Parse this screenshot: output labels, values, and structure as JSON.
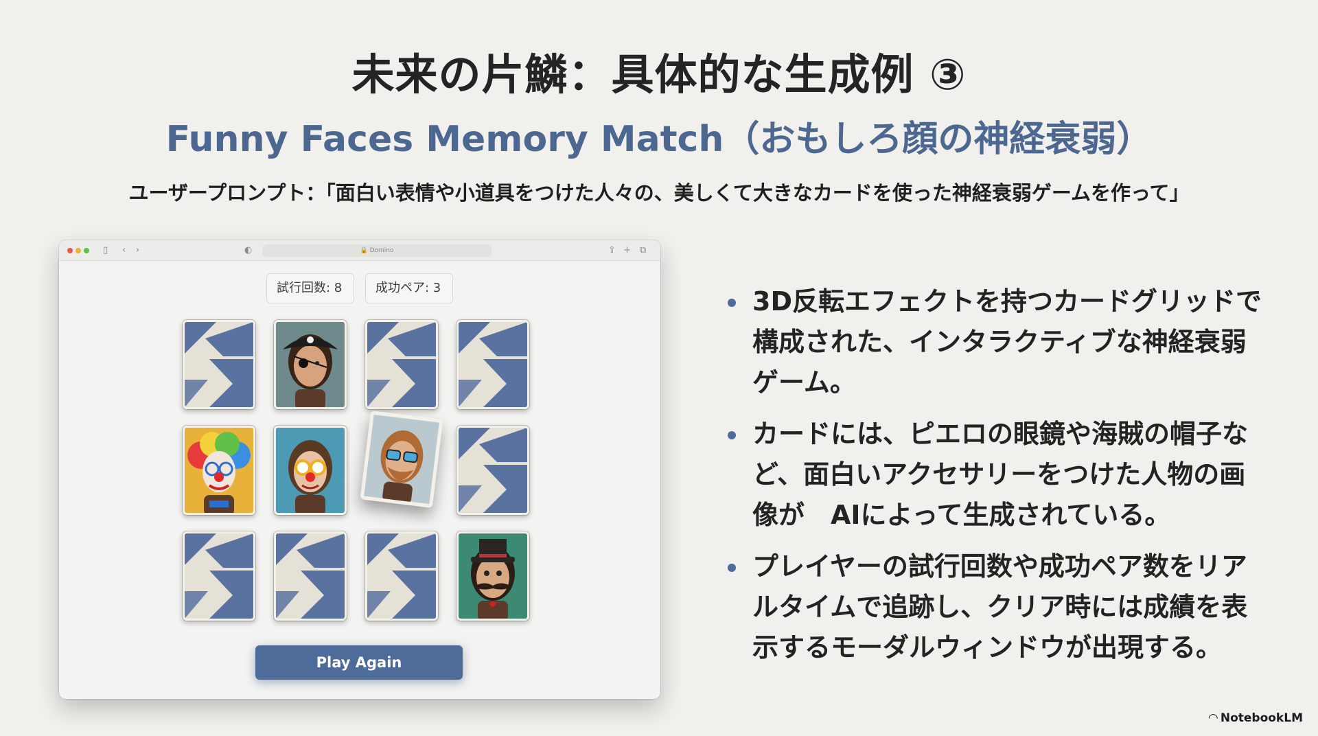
{
  "slide": {
    "title": "未来の片鱗：具体的な生成例 ③",
    "subtitle": "Funny Faces Memory Match（おもしろ顔の神経衰弱）",
    "prompt": "ユーザープロンプト：「面白い表情や小道具をつけた人々の、美しくて大きなカードを使った神経衰弱ゲームを作って」"
  },
  "browser": {
    "address": "🔒 Domino",
    "icons": [
      "sidebar-icon",
      "back-icon",
      "forward-icon",
      "shield-icon",
      "share-icon",
      "new-tab-icon",
      "tabs-icon"
    ]
  },
  "game": {
    "attempts_label": "試行回数: 8",
    "pairs_label": "成功ペア: 3",
    "play_again": "Play Again",
    "cards": [
      {
        "state": "back"
      },
      {
        "state": "face",
        "face": "pirate"
      },
      {
        "state": "back"
      },
      {
        "state": "back"
      },
      {
        "state": "face",
        "face": "clown-rainbow-wig"
      },
      {
        "state": "face",
        "face": "man-clown-glasses"
      },
      {
        "state": "face",
        "face": "bearded-man-sunglasses",
        "flipping": true
      },
      {
        "state": "back"
      },
      {
        "state": "back"
      },
      {
        "state": "back"
      },
      {
        "state": "back"
      },
      {
        "state": "face",
        "face": "mustache-top-hat"
      }
    ],
    "colors": {
      "accent": "#4e6c99",
      "card_pattern": "#5a72a0",
      "card_base": "#e6e1d6"
    }
  },
  "bullets": [
    "3D反転エフェクトを持つカードグリッドで構成された、インタラクティブな神経衰弱ゲーム。",
    "カードには、ピエロの眼鏡や海賊の帽子など、面白いアクセサリーをつけた人物の画像が　AIによって生成されている。",
    "プレイヤーの試行回数や成功ペア数をリアルタイムで追跡し、クリア時には成績を表示するモーダルウィンドウが出現する。"
  ],
  "footer": {
    "brand": "NotebookLM"
  }
}
